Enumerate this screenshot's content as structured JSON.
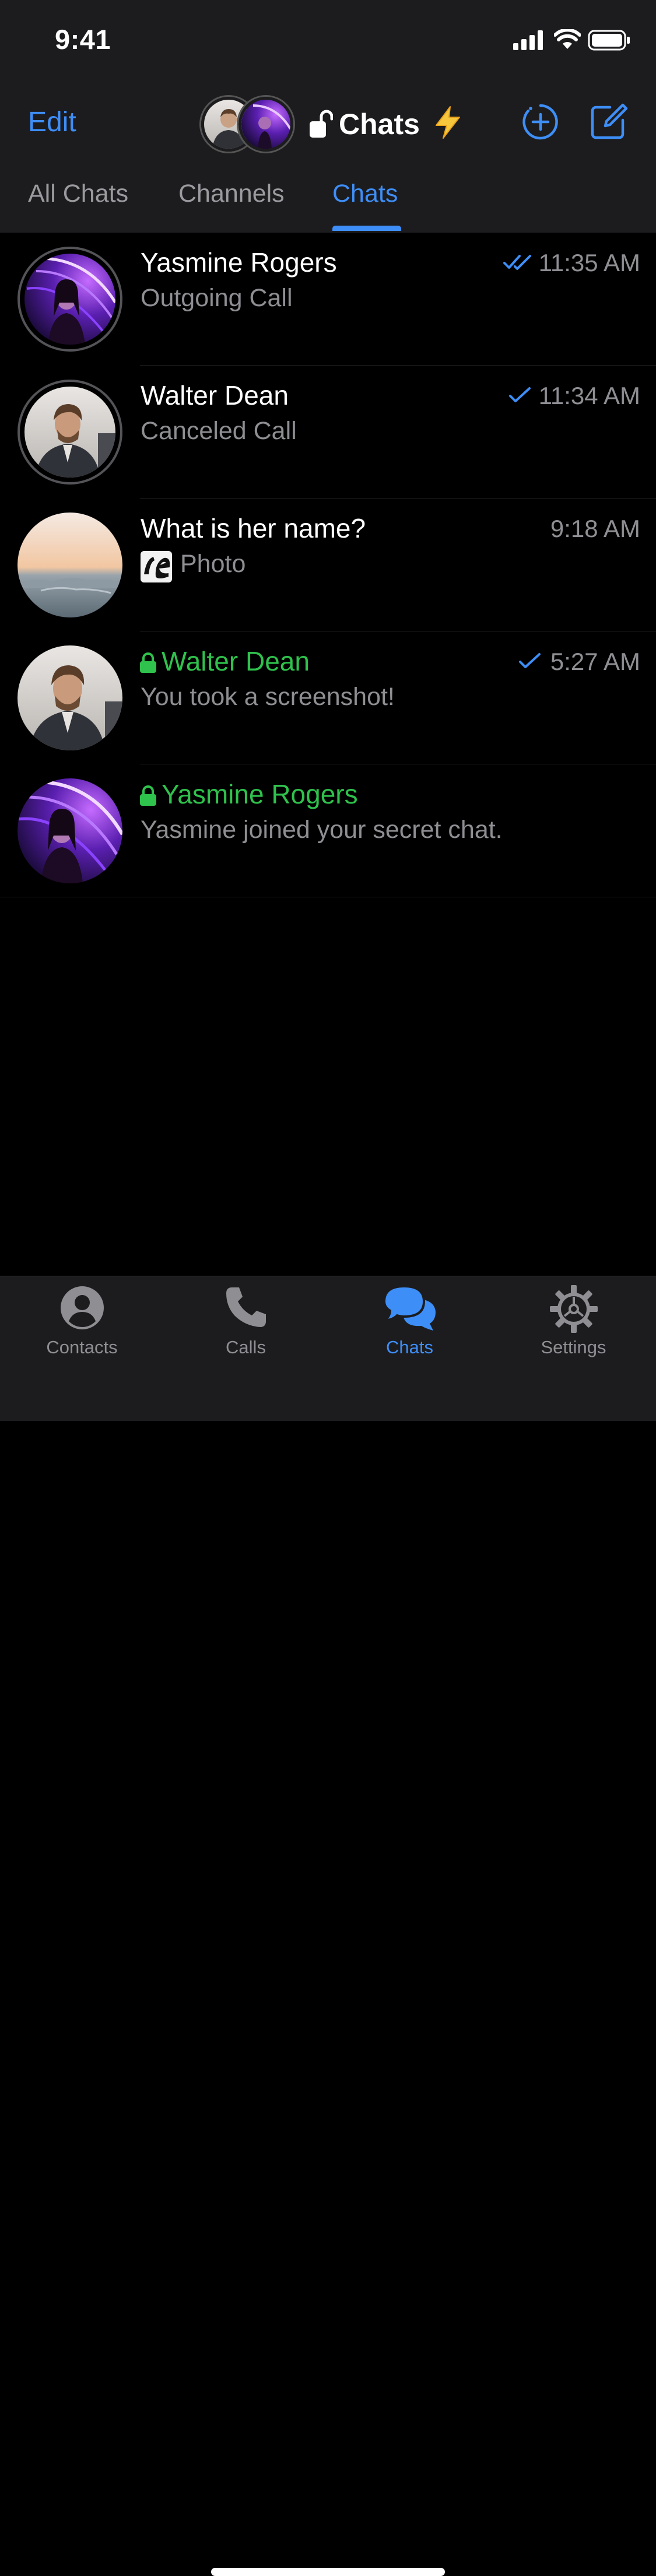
{
  "status": {
    "time": "9:41"
  },
  "header": {
    "edit": "Edit",
    "title": "Chats",
    "title_emoji": "⚡"
  },
  "tabs": [
    {
      "label": "All Chats",
      "active": false
    },
    {
      "label": "Channels",
      "active": false
    },
    {
      "label": "Chats",
      "active": true
    }
  ],
  "chats": [
    {
      "name": "Yasmine Rogers",
      "subtitle": "Outgoing Call",
      "time": "11:35 AM",
      "receipt": "double-check",
      "secret": false
    },
    {
      "name": "Walter Dean",
      "subtitle": "Canceled Call",
      "time": "11:34 AM",
      "receipt": "single-check",
      "secret": false
    },
    {
      "name": "What is her name?",
      "subtitle": "Photo",
      "time": "9:18 AM",
      "receipt": "none",
      "secret": false
    },
    {
      "name": "Walter Dean",
      "subtitle": "You took a screenshot!",
      "time": "5:27 AM",
      "receipt": "single-check",
      "secret": true
    },
    {
      "name": "Yasmine Rogers",
      "subtitle": "Yasmine joined your secret chat.",
      "time": "",
      "receipt": "none",
      "secret": true
    }
  ],
  "tabbar": [
    {
      "label": "Contacts",
      "icon": "person-circle-icon",
      "active": false
    },
    {
      "label": "Calls",
      "icon": "phone-icon",
      "active": false
    },
    {
      "label": "Chats",
      "icon": "chat-bubbles-icon",
      "active": true
    },
    {
      "label": "Settings",
      "icon": "gear-icon",
      "active": false
    }
  ],
  "colors": {
    "accent": "#3e8ef7",
    "secret_green": "#2fc24c",
    "header_bg": "#1c1c1e",
    "list_bg": "#000000",
    "secondary_text": "#8e8e93"
  }
}
